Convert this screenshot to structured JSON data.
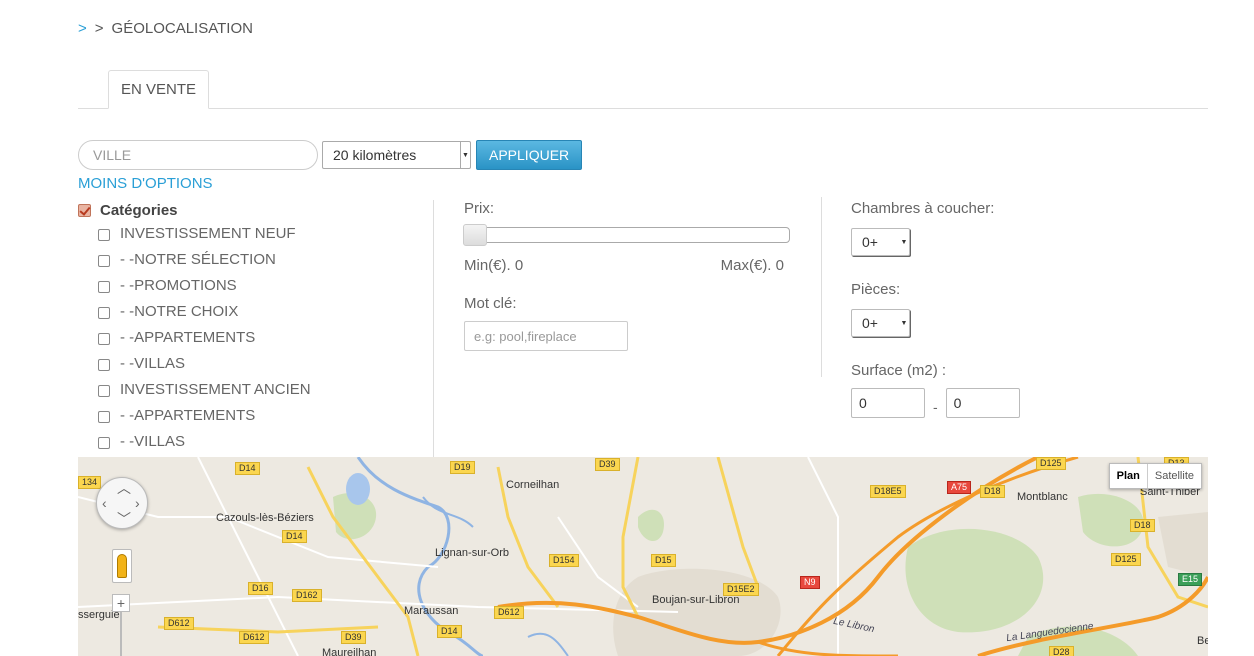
{
  "breadcrumb": {
    "home_sep": ">",
    "sep": ">",
    "current": "GÉOLOCALISATION"
  },
  "tabs": [
    {
      "label": "EN VENTE"
    }
  ],
  "search": {
    "city_placeholder": "VILLE",
    "radius_value": "20 kilomètres",
    "apply_label": "APPLIQUER",
    "less_options_label": "MOINS D'OPTIONS"
  },
  "categories": {
    "title": "Catégories",
    "items": [
      {
        "label": "INVESTISSEMENT NEUF"
      },
      {
        "label": "- -NOTRE SÉLECTION"
      },
      {
        "label": "- -PROMOTIONS"
      },
      {
        "label": "- -NOTRE CHOIX"
      },
      {
        "label": "- -APPARTEMENTS"
      },
      {
        "label": "- -VILLAS"
      },
      {
        "label": "INVESTISSEMENT ANCIEN"
      },
      {
        "label": "- -APPARTEMENTS"
      },
      {
        "label": "- -VILLAS"
      }
    ]
  },
  "price": {
    "label": "Prix:",
    "min_label": "Min(€). 0",
    "max_label": "Max(€). 0",
    "slider_fraction": 0
  },
  "keyword": {
    "label": "Mot clé:",
    "placeholder": "e.g: pool,fireplace"
  },
  "bedrooms": {
    "label": "Chambres à coucher:",
    "value": "0+"
  },
  "rooms": {
    "label": "Pièces:",
    "value": "0+"
  },
  "surface": {
    "label": "Surface (m2) :",
    "min": "0",
    "sep": "-",
    "max": "0"
  },
  "map": {
    "type_plan": "Plan",
    "type_satellite": "Satellite",
    "zoom_in": "+",
    "places": {
      "corneilhan": "Corneilhan",
      "cazouls": "Cazouls-lès-Béziers",
      "lignan": "Lignan-sur-Orb",
      "boujan": "Boujan-sur-Libron",
      "maraussan": "Maraussan",
      "montblanc": "Montblanc",
      "saint_thibery": "Saint-Thibér",
      "maureilhan": "Maureilhan",
      "puisserguier": "sserguie",
      "bessan": "Bes",
      "le_libron": "Le Libron",
      "languedocienne": "La Languedocienne"
    },
    "roads": {
      "d134": "134",
      "d14a": "D14",
      "d19": "D19",
      "d39a": "D39",
      "d14b": "D14",
      "d154": "D154",
      "d15": "D15",
      "d15e2": "D15E2",
      "d16": "D16",
      "d162": "D162",
      "d612a": "D612",
      "d612b": "D612",
      "d612c": "D612",
      "d39b": "D39",
      "d14c": "D14",
      "n9": "N9",
      "d18e5": "D18E5",
      "a75": "A75",
      "d18a": "D18",
      "d125a": "D125",
      "d13": "D13",
      "d18b": "D18",
      "d125b": "D125",
      "e15": "E15",
      "d28": "D28"
    }
  }
}
